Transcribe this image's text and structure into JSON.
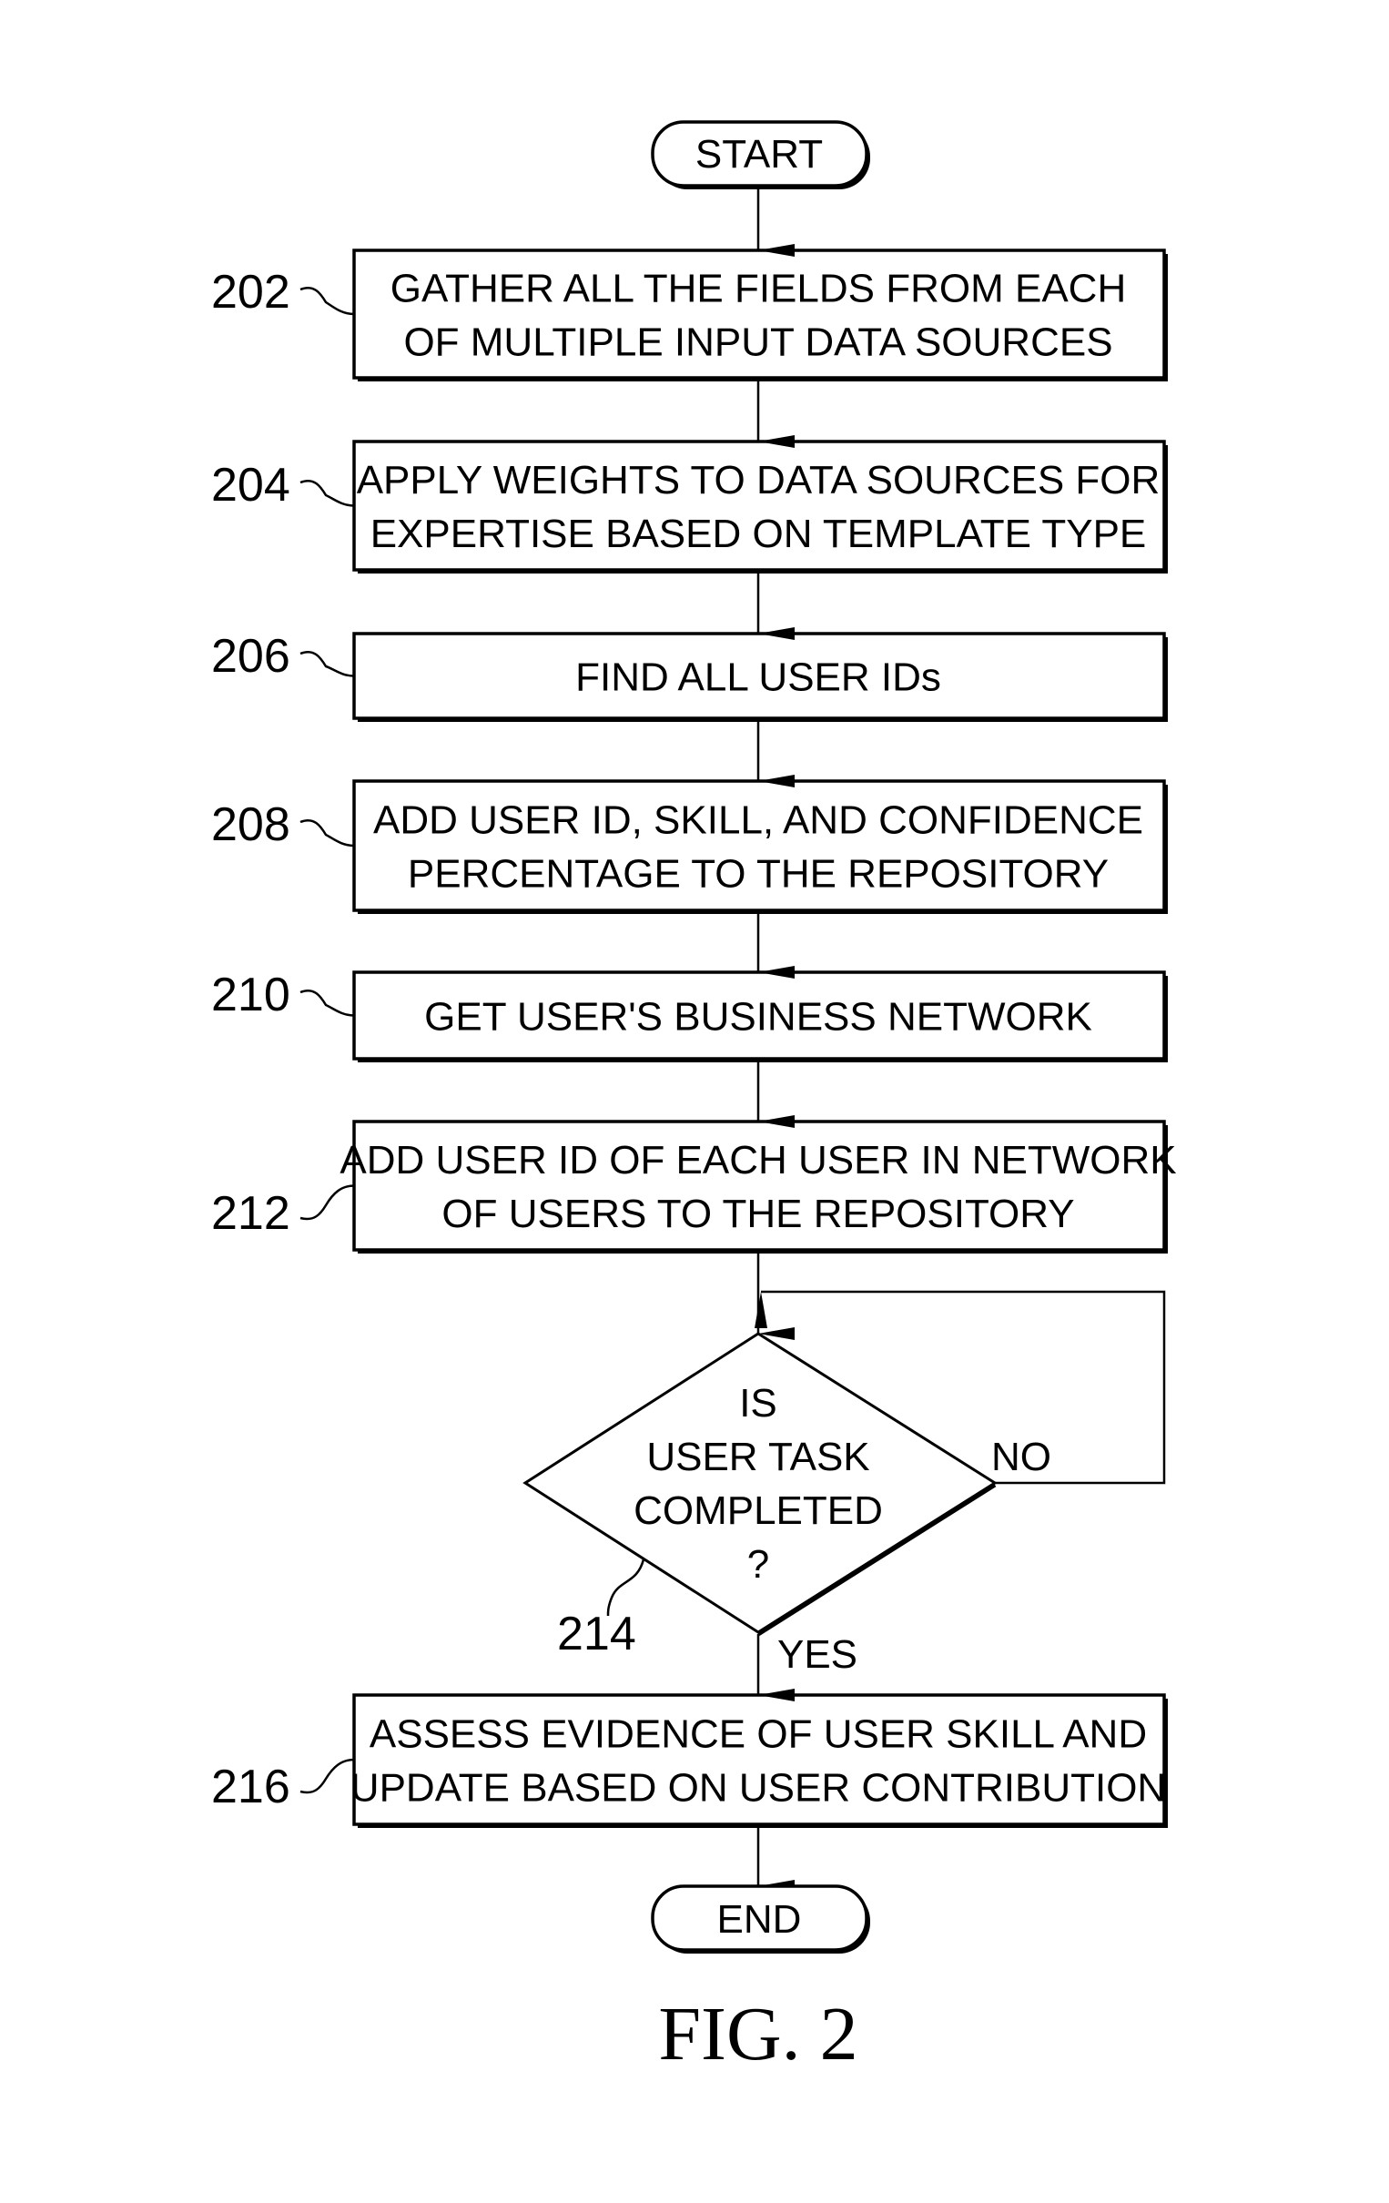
{
  "figure": {
    "caption": "FIG. 2",
    "start_label": "START",
    "end_label": "END",
    "steps": [
      {
        "ref": "202",
        "lines": [
          "GATHER ALL THE FIELDS FROM EACH",
          "OF MULTIPLE INPUT DATA SOURCES"
        ]
      },
      {
        "ref": "204",
        "lines": [
          "APPLY WEIGHTS TO DATA SOURCES FOR",
          "EXPERTISE BASED ON TEMPLATE TYPE"
        ]
      },
      {
        "ref": "206",
        "lines": [
          "FIND ALL USER IDs"
        ]
      },
      {
        "ref": "208",
        "lines": [
          "ADD USER ID, SKILL, AND CONFIDENCE",
          "PERCENTAGE TO THE REPOSITORY"
        ]
      },
      {
        "ref": "210",
        "lines": [
          "GET USER'S BUSINESS NETWORK"
        ]
      },
      {
        "ref": "212",
        "lines": [
          "ADD USER ID OF EACH USER IN NETWORK",
          "OF USERS TO THE REPOSITORY"
        ]
      }
    ],
    "decision": {
      "ref": "214",
      "lines": [
        "IS",
        "USER TASK",
        "COMPLETED",
        "?"
      ],
      "no_label": "NO",
      "yes_label": "YES"
    },
    "final_step": {
      "ref": "216",
      "lines": [
        "ASSESS EVIDENCE OF USER SKILL AND",
        "UPDATE BASED ON USER CONTRIBUTION"
      ]
    }
  }
}
